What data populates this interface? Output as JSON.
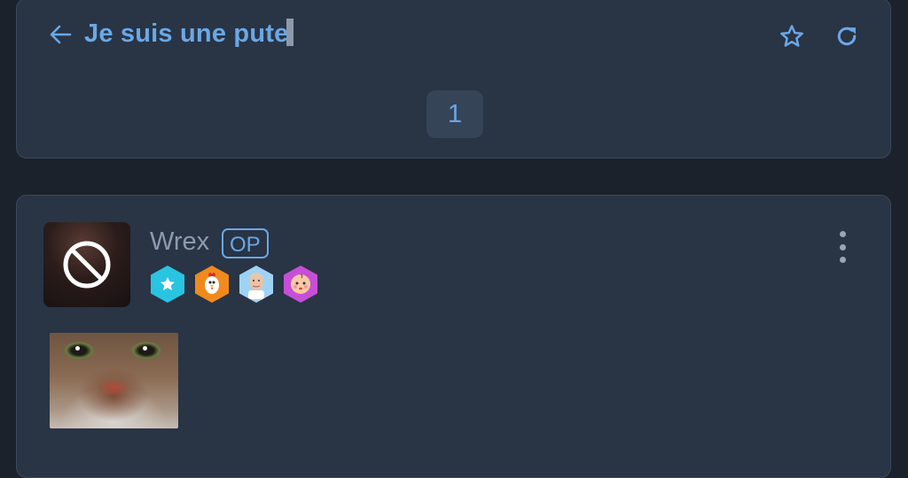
{
  "topic": {
    "back_icon": "arrow-left-icon",
    "title": "Je suis une pute",
    "favorite_icon": "star-outline-icon",
    "refresh_icon": "refresh-icon",
    "current_page": "1"
  },
  "post": {
    "author": "Wrex",
    "op_label": "OP",
    "avatar_icon": "banned-avatar-icon",
    "menu_icon": "more-vertical-icon",
    "badges": [
      {
        "name": "star-badge-icon",
        "color": "#29c4e0"
      },
      {
        "name": "rooster-badge-icon",
        "color": "#f08a1c"
      },
      {
        "name": "old-man-badge-icon",
        "color": "#9fd3f5"
      },
      {
        "name": "baby-badge-icon",
        "color": "#c74fd8"
      }
    ],
    "image": "cat-face-image"
  },
  "colors": {
    "background": "#1b222b",
    "card": "#293445",
    "accent": "#6aa8e6",
    "muted_text": "#8c9bb0"
  }
}
